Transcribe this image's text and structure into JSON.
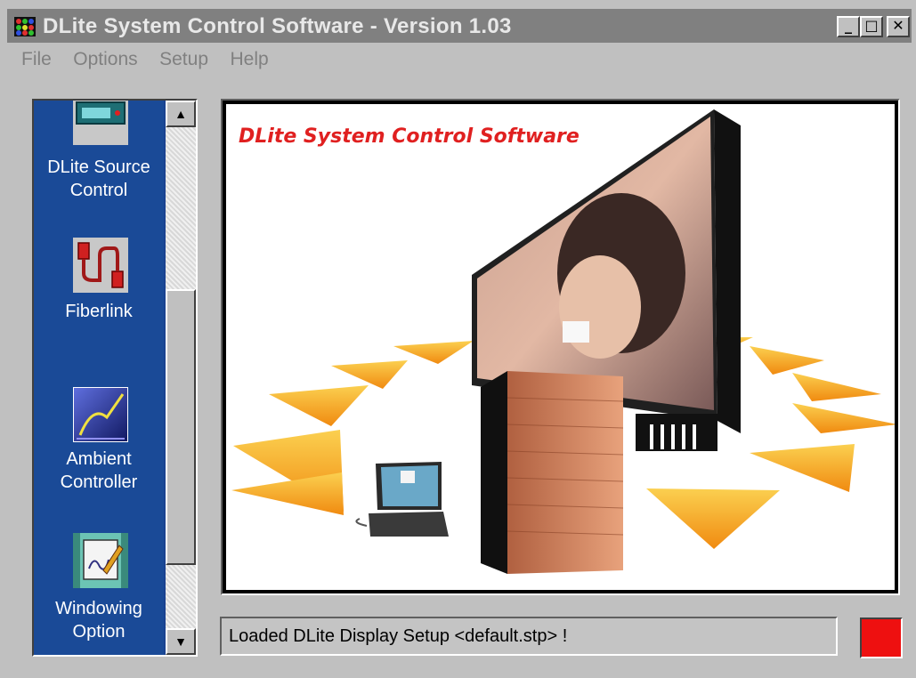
{
  "window": {
    "title": "DLite System Control Software - Version 1.03",
    "controls": {
      "minimize": "_",
      "maximize": "□",
      "close": "✕"
    }
  },
  "menu": {
    "items": [
      {
        "label": "File"
      },
      {
        "label": "Options"
      },
      {
        "label": "Setup"
      },
      {
        "label": "Help"
      }
    ]
  },
  "sidebar": {
    "items": [
      {
        "label_line1": "DLite Source",
        "label_line2": "Control",
        "icon": "source-control-device-icon"
      },
      {
        "label_line1": "Fiberlink",
        "label_line2": "",
        "icon": "fiberlink-cable-icon"
      },
      {
        "label_line1": "Ambient",
        "label_line2": "Controller",
        "icon": "ambient-controller-icon"
      },
      {
        "label_line1": "Windowing",
        "label_line2": "Option",
        "icon": "windowing-option-icon"
      }
    ],
    "scroll_up": "▲",
    "scroll_down": "▼"
  },
  "splash": {
    "title": "DLite System Control Software"
  },
  "status": {
    "message": "Loaded DLite Display Setup <default.stp> !",
    "indicator_color": "#ee1010"
  },
  "colors": {
    "sidebar_bg": "#1a4a97",
    "title_bar": "#808080",
    "splash_title": "#e02020",
    "triangle_orange": "#f6a21a"
  }
}
